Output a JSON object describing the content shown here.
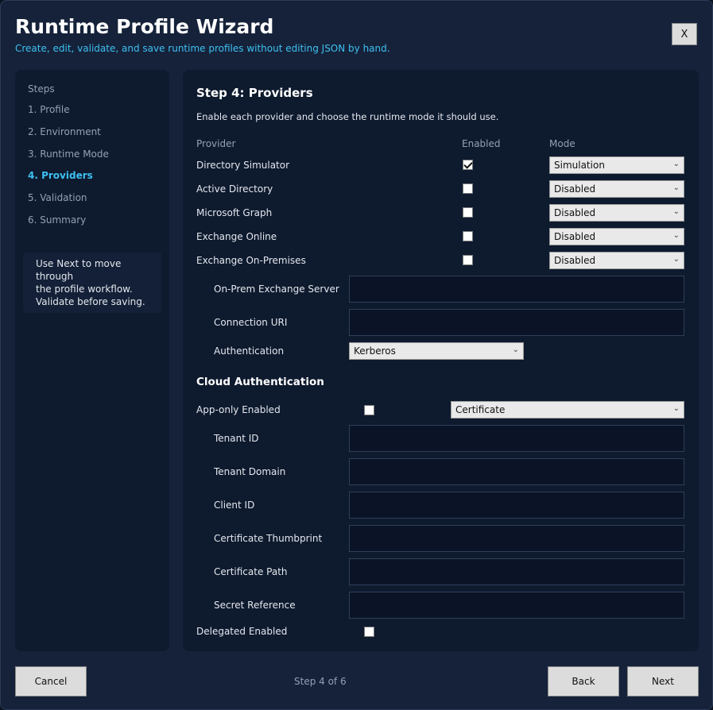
{
  "window": {
    "title": "Runtime Profile Wizard",
    "subtitle": "Create, edit, validate, and save runtime profiles without editing JSON by hand.",
    "close_label": "X"
  },
  "sidebar": {
    "heading": "Steps",
    "steps": [
      {
        "label": "1. Profile",
        "active": false
      },
      {
        "label": "2. Environment",
        "active": false
      },
      {
        "label": "3. Runtime Mode",
        "active": false
      },
      {
        "label": "4. Providers",
        "active": true
      },
      {
        "label": "5. Validation",
        "active": false
      },
      {
        "label": "6. Summary",
        "active": false
      }
    ],
    "hint_lines": [
      "Use Next to move through",
      "the profile workflow.",
      "Validate before saving."
    ]
  },
  "providers": {
    "title": "Step 4: Providers",
    "description": "Enable each provider and choose the runtime mode it should use.",
    "columns": {
      "provider": "Provider",
      "enabled": "Enabled",
      "mode": "Mode"
    },
    "rows": [
      {
        "name": "Directory Simulator",
        "enabled": true,
        "mode": "Simulation"
      },
      {
        "name": "Active Directory",
        "enabled": false,
        "mode": "Disabled"
      },
      {
        "name": "Microsoft Graph",
        "enabled": false,
        "mode": "Disabled"
      },
      {
        "name": "Exchange Online",
        "enabled": false,
        "mode": "Disabled"
      },
      {
        "name": "Exchange On-Premises",
        "enabled": false,
        "mode": "Disabled"
      }
    ],
    "onprem": {
      "server_label": "On-Prem Exchange Server",
      "server_value": "",
      "uri_label": "Connection URI",
      "uri_value": "",
      "auth_label": "Authentication",
      "auth_value": "Kerberos"
    }
  },
  "cloud": {
    "title": "Cloud Authentication",
    "app_only_label": "App-only Enabled",
    "app_only_enabled": false,
    "app_only_mode": "Certificate",
    "fields": [
      {
        "label": "Tenant ID",
        "value": ""
      },
      {
        "label": "Tenant Domain",
        "value": ""
      },
      {
        "label": "Client ID",
        "value": ""
      },
      {
        "label": "Certificate Thumbprint",
        "value": ""
      },
      {
        "label": "Certificate Path",
        "value": ""
      },
      {
        "label": "Secret Reference",
        "value": ""
      }
    ],
    "delegated_label": "Delegated Enabled",
    "delegated_enabled": false
  },
  "footer": {
    "cancel_label": "Cancel",
    "status": "Step 4 of 6",
    "back_label": "Back",
    "next_label": "Next"
  },
  "icons": {
    "dropdown": "chevron-down-icon",
    "checkbox_mark": "checkmark-icon"
  },
  "colors": {
    "accent": "#3ec0f0",
    "background": "#15223a",
    "panel": "#0e1a2e"
  }
}
